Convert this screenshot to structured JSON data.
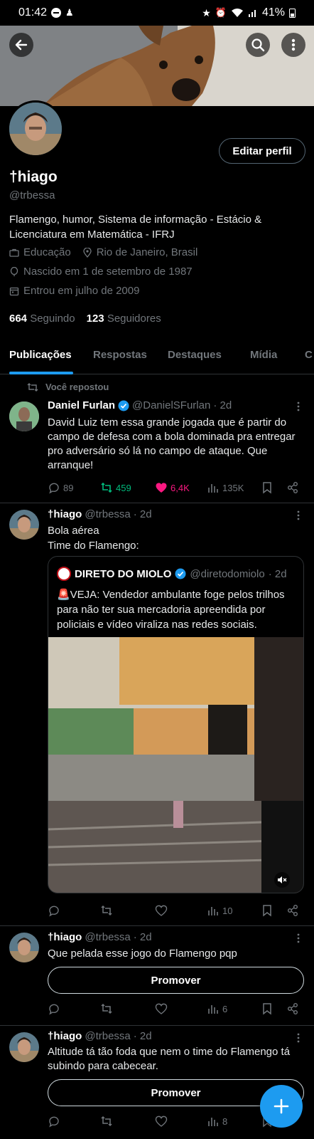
{
  "statusbar": {
    "time": "01:42",
    "battery": "41%"
  },
  "profile": {
    "edit_label": "Editar perfil",
    "name": "†hiago",
    "handle": "@trbessa",
    "bio": "Flamengo, humor,  Sistema de informação - Estácio & Licenciatura em Matemática - IFRJ",
    "category": "Educação",
    "location": "Rio de Janeiro, Brasil",
    "birth": "Nascido em 1 de setembro de 1987",
    "joined": "Entrou em julho de 2009",
    "following_count": "664",
    "following_label": "Seguindo",
    "followers_count": "123",
    "followers_label": "Seguidores"
  },
  "tabs": [
    "Publicações",
    "Respostas",
    "Destaques",
    "Mídia",
    "C"
  ],
  "posts": [
    {
      "repost_label": "Você repostou",
      "author": "Daniel Furlan",
      "handle": "@DanielSFurlan",
      "time": "· 2d",
      "text": "David Luiz tem essa grande jogada que é partir do campo de defesa com a bola dominada pra entregar pro adversário só lá no campo de ataque. Que arranque!",
      "replies": "89",
      "reposts": "459",
      "likes": "6,4K",
      "views": "135K"
    },
    {
      "author": "†hiago",
      "handle": "@trbessa",
      "time": "· 2d",
      "text_line1": "Bola aérea",
      "text_line2": "Time do Flamengo:",
      "quote": {
        "author": "DIRETO DO MIOLO",
        "handle": "@diretodomiolo",
        "time": "· 2d",
        "text": "🚨VEJA: Vendedor ambulante foge pelos trilhos para não ter sua mercadoria apreendida por policiais e vídeo viraliza nas redes sociais."
      },
      "views": "10"
    },
    {
      "author": "†hiago",
      "handle": "@trbessa",
      "time": "· 2d",
      "text": "Que pelada esse jogo do Flamengo pqp",
      "promote_label": "Promover",
      "views": "6"
    },
    {
      "author": "†hiago",
      "handle": "@trbessa",
      "time": "· 2d",
      "text": "Altitude tá tão foda que nem o time do Flamengo tá subindo para cabecear.",
      "promote_label": "Promover",
      "views": "8"
    }
  ],
  "colors": {
    "accent": "#1d9bf0",
    "retweet": "#00ba7c",
    "like": "#f91880",
    "muted": "#71767b"
  }
}
